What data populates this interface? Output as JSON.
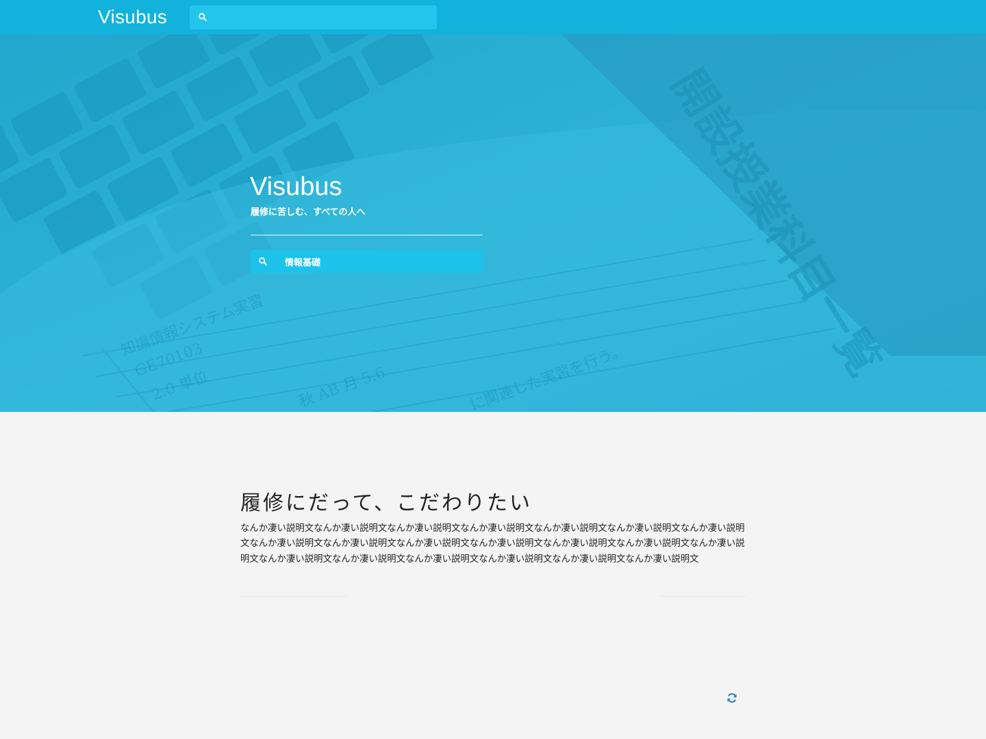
{
  "navbar": {
    "brand": "Visubus",
    "search": {
      "value": "",
      "placeholder": ""
    },
    "search_icon": "search-icon"
  },
  "hero": {
    "title": "Visubus",
    "subtitle": "履修に苦しむ、すべての人へ",
    "search": {
      "value": "情報基礎",
      "placeholder": ""
    },
    "search_icon": "search-icon",
    "background": "blue-tinted photo of a keyboard and a course catalog book"
  },
  "content": {
    "heading": "履修にだって、こだわりたい",
    "body": "なんか凄い説明文なんか凄い説明文なんか凄い説明文なんか凄い説明文なんか凄い説明文なんか凄い説明文なんか凄い説明文なんか凄い説明文なんか凄い説明文なんか凄い説明文なんか凄い説明文なんか凄い説明文なんか凄い説明文なんか凄い説明文なんか凄い説明文なんか凄い説明文なんか凄い説明文なんか凄い説明文なんか凄い説明文なんか凄い説明文"
  },
  "refresh_icon": "refresh-icon",
  "colors": {
    "navbar": "#12b2dc",
    "search_field": "#22c6ec",
    "hero": "#2aaed3",
    "page_background": "#f4f4f4",
    "text": "#222222",
    "refresh_icon": "#2d7fc0"
  }
}
